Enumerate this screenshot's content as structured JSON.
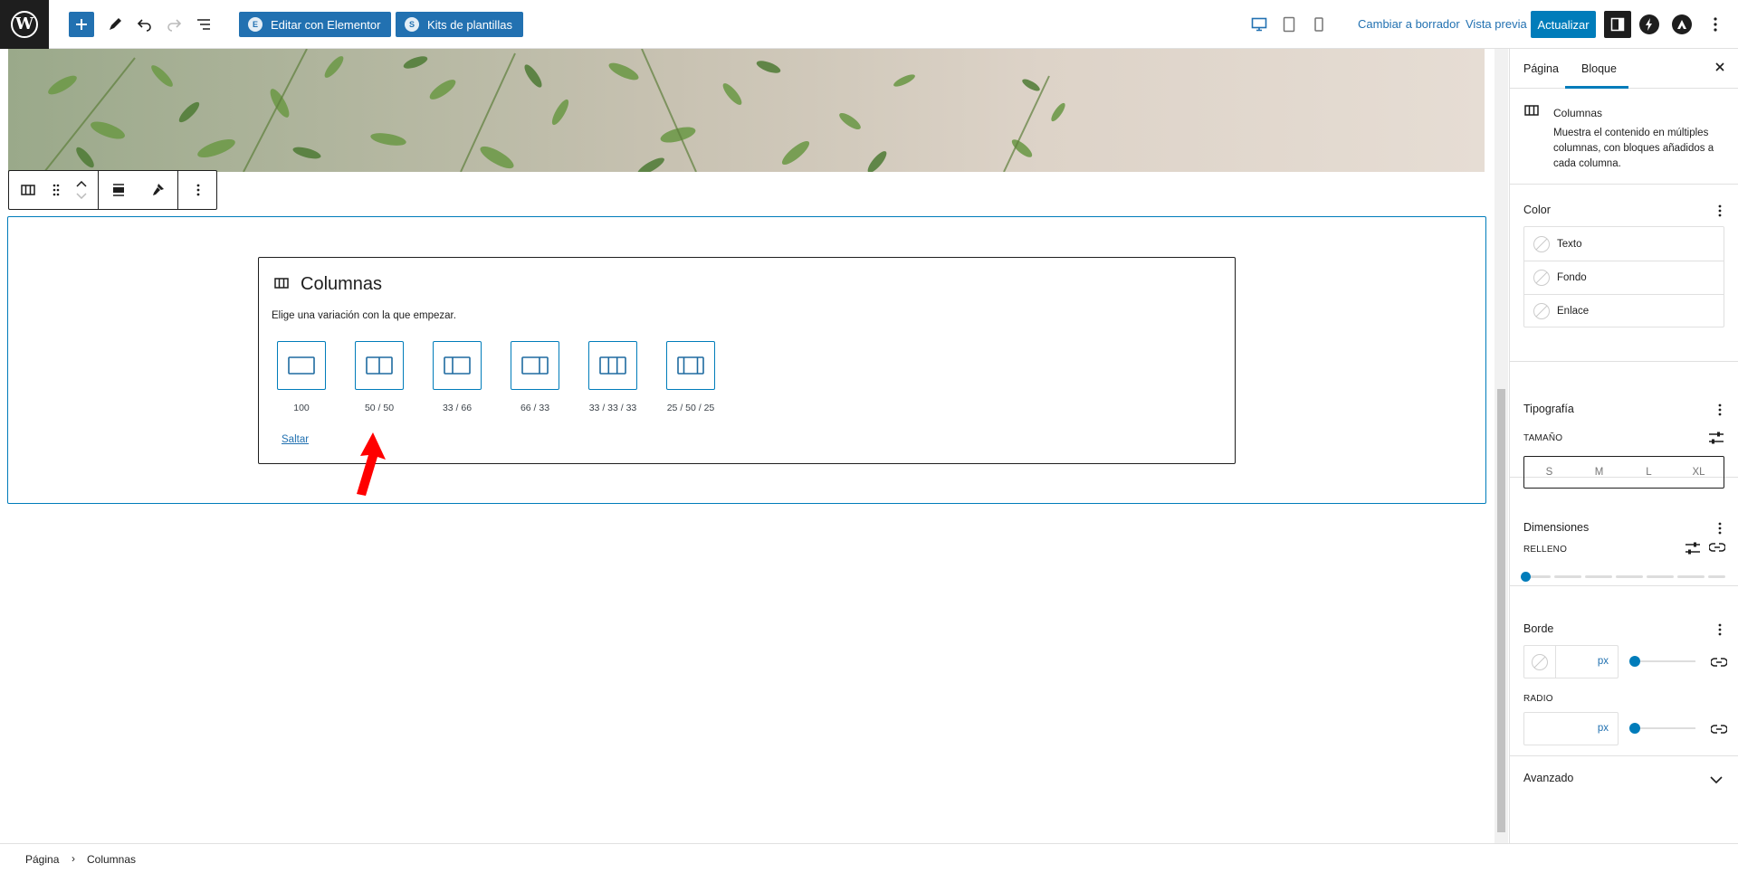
{
  "toolbar": {
    "elementor_button": "Editar con Elementor",
    "kits_button": "Kits de plantillas",
    "switch_to_draft": "Cambiar a borrador",
    "preview": "Vista previa",
    "update": "Actualizar"
  },
  "block_toolbar": {
    "block_icon": "columns-icon",
    "drag_icon": "drag-handle-icon",
    "move_up_icon": "chevron-up-icon",
    "move_down_icon": "chevron-down-icon",
    "align_icon": "align-icon",
    "styles_icon": "brush-icon",
    "options_icon": "more-vertical-icon"
  },
  "placeholder": {
    "title": "Columnas",
    "instructions": "Elige una variación con la que empezar.",
    "variations": [
      {
        "label": "100"
      },
      {
        "label": "50 / 50"
      },
      {
        "label": "33 / 66"
      },
      {
        "label": "66 / 33"
      },
      {
        "label": "33 / 33 / 33"
      },
      {
        "label": "25 / 50 / 25"
      }
    ],
    "skip": "Saltar"
  },
  "sidebar": {
    "tabs": [
      "Página",
      "Bloque"
    ],
    "active_tab": "Bloque",
    "block_card": {
      "title": "Columnas",
      "description": "Muestra el contenido en múltiples columnas, con bloques añadidos a cada columna."
    },
    "color_panel": {
      "title": "Color",
      "items": [
        "Texto",
        "Fondo",
        "Enlace"
      ]
    },
    "typography_panel": {
      "title": "Tipografía",
      "size_label": "TAMAÑO",
      "sizes": [
        "S",
        "M",
        "L",
        "XL"
      ]
    },
    "dimensions_panel": {
      "title": "Dimensiones",
      "padding_label": "RELLENO"
    },
    "border_panel": {
      "title": "Borde",
      "unit": "px",
      "radius_label": "RADIO",
      "radius_unit": "px"
    },
    "advanced_panel": {
      "title": "Avanzado"
    }
  },
  "breadcrumbs": [
    "Página",
    "Columnas"
  ],
  "colors": {
    "accent": "#007cba",
    "link": "#2271b1",
    "dark": "#1e1e1e",
    "annotation_arrow": "#ff0000"
  }
}
